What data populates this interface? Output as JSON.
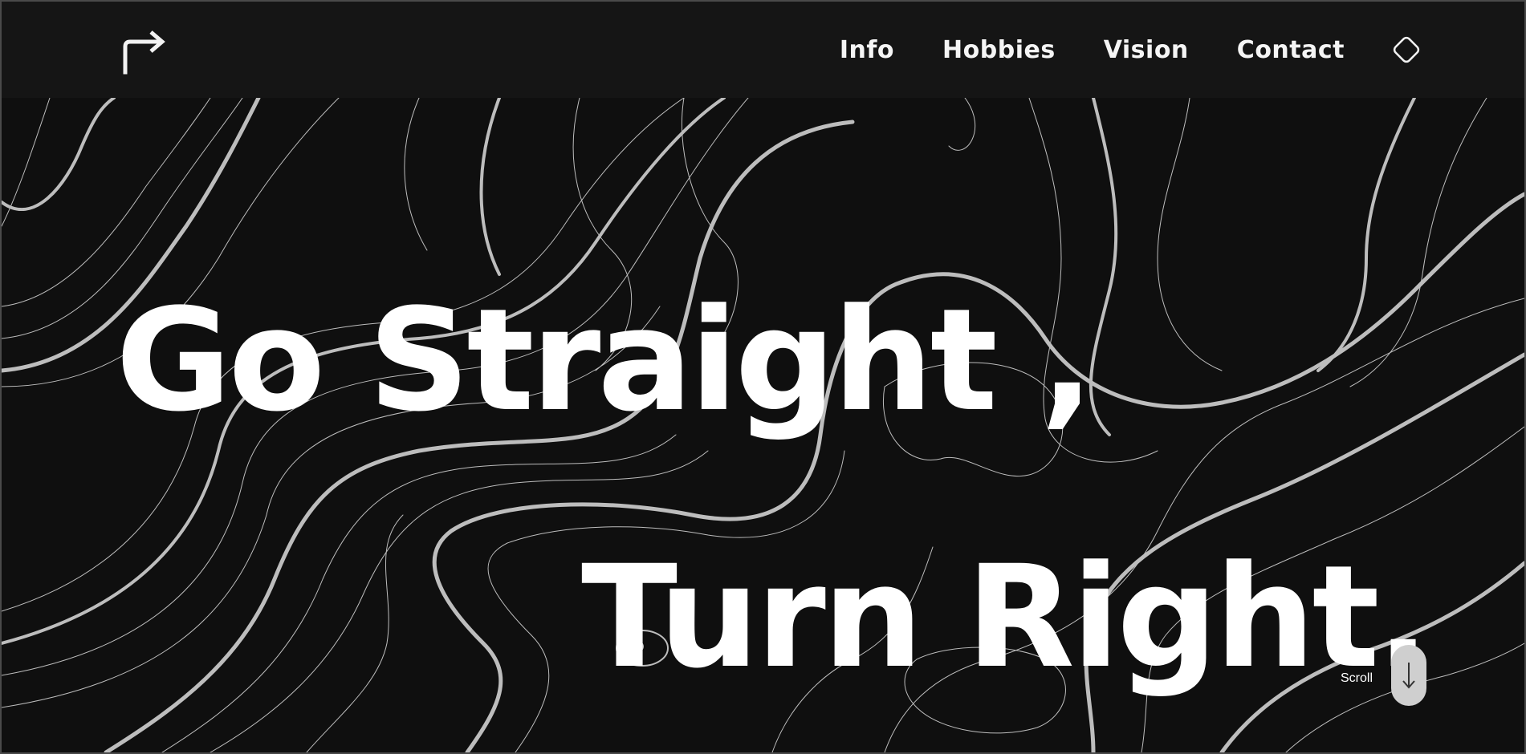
{
  "header": {
    "logo_icon": "arrow-turn-right-icon",
    "nav": [
      {
        "label": "Info"
      },
      {
        "label": "Hobbies"
      },
      {
        "label": "Vision"
      },
      {
        "label": "Contact"
      }
    ],
    "extra_icon": "diamond-icon"
  },
  "hero": {
    "line1": "Go Straight ,",
    "line2": "Turn Right.",
    "scroll_label": "Scroll",
    "scroll_icon": "arrow-down-icon"
  },
  "colors": {
    "background": "#0f0f0f",
    "topbar": "#151515",
    "text": "#ffffff",
    "contour": "#bdbdbd"
  }
}
